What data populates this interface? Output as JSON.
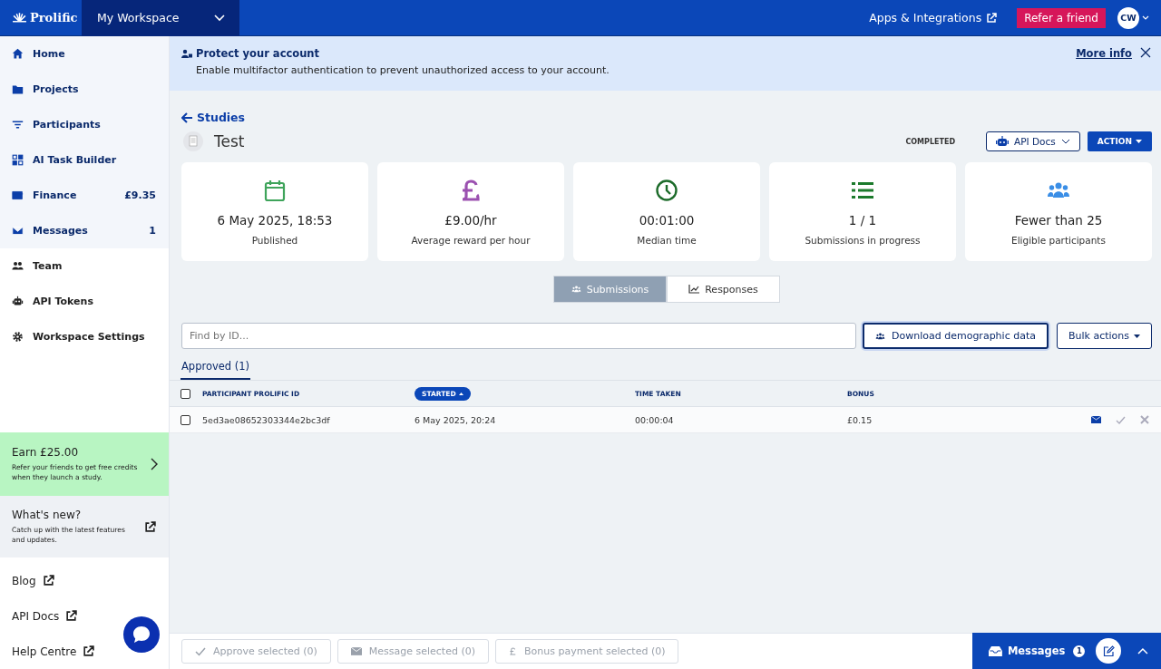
{
  "topbar": {
    "brand": "Prolific",
    "workspace": "My Workspace",
    "apps_link": "Apps & Integrations",
    "refer_button": "Refer a friend",
    "avatar": "CW"
  },
  "sidebar": {
    "primary_items": [
      {
        "label": "Home"
      },
      {
        "label": "Projects"
      },
      {
        "label": "Participants"
      },
      {
        "label": "AI Task Builder"
      },
      {
        "label": "Finance",
        "badge": "£9.35"
      },
      {
        "label": "Messages",
        "badge": "1"
      }
    ],
    "secondary_items": [
      {
        "label": "Team"
      },
      {
        "label": "API Tokens"
      },
      {
        "label": "Workspace Settings"
      }
    ],
    "promo": {
      "title": "Earn £25.00",
      "text": "Refer your friends to get free credits when they launch a study."
    },
    "whats_new": {
      "title": "What's new?",
      "text": "Catch up with the latest features and updates."
    },
    "links": [
      "Blog",
      "API Docs",
      "Help Centre"
    ]
  },
  "banner": {
    "title": "Protect your account",
    "text": "Enable multifactor authentication to prevent unauthorized access to your account.",
    "link": "More info"
  },
  "study": {
    "back_link": "Studies",
    "title": "Test",
    "status": "COMPLETED",
    "api_docs_button": "API Docs",
    "action_button": "ACTION"
  },
  "stats": [
    {
      "color": "#3fa45b",
      "value": "6 May 2025, 18:53",
      "label": "Published"
    },
    {
      "color": "#9b51b0",
      "value": "£9.00/hr",
      "label": "Average reward per hour"
    },
    {
      "color": "#1c6b2a",
      "value": "00:01:00",
      "label": "Median time"
    },
    {
      "color": "#1c7a2c",
      "value": "1 / 1",
      "label": "Submissions in progress"
    },
    {
      "color": "#3a8ee6",
      "value": "Fewer than 25",
      "label": "Eligible participants"
    }
  ],
  "view_tabs": [
    {
      "label": "Submissions",
      "selected": true
    },
    {
      "label": "Responses",
      "selected": false
    }
  ],
  "search": {
    "placeholder": "Find by ID..."
  },
  "download_button": "Download demographic data",
  "bulk_button": "Bulk actions",
  "status_tabs": [
    {
      "label": "Approved (1)",
      "selected": true
    }
  ],
  "table": {
    "select_all": {
      "checked": false
    },
    "columns": [
      {
        "label": "PARTICIPANT PROLIFIC ID",
        "sorted": false
      },
      {
        "label": "STARTED",
        "sorted": true
      },
      {
        "label": "TIME TAKEN",
        "sorted": false
      },
      {
        "label": "BONUS",
        "sorted": false
      }
    ],
    "rows": [
      {
        "checked": false,
        "cells": [
          "5ed3ae08652303344e2bc3df",
          "6 May 2025, 20:24",
          "00:00:04",
          "£0.15"
        ]
      }
    ]
  },
  "bottom_actions": [
    {
      "label": "Approve selected (0)",
      "disabled": true
    },
    {
      "label": "Message selected (0)",
      "disabled": true
    },
    {
      "label": "Bonus payment selected (0)",
      "disabled": true
    }
  ],
  "messages_dock": {
    "label": "Messages",
    "count": "1"
  }
}
